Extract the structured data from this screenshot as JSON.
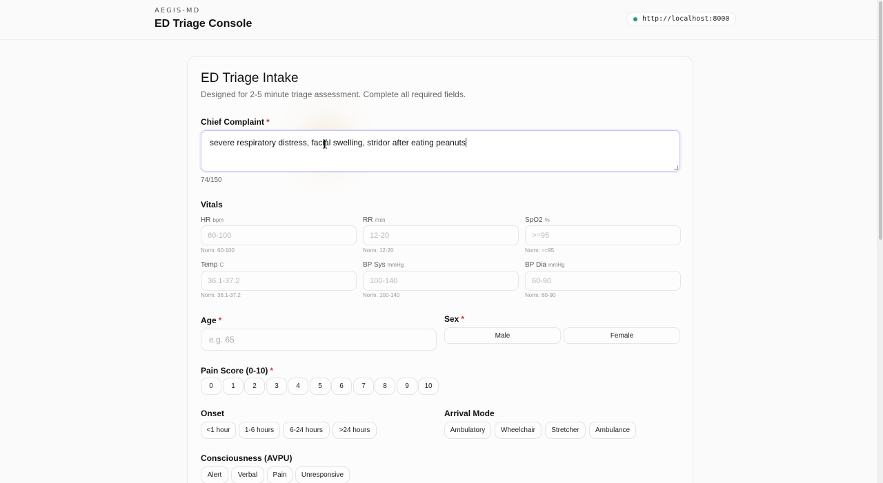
{
  "header": {
    "brand_small": "AEGIS-MD",
    "brand_title": "ED Triage Console",
    "status_url": "http://localhost:8000",
    "status_color": "#1aa06b"
  },
  "form": {
    "title": "ED Triage Intake",
    "subtitle": "Designed for 2-5 minute triage assessment. Complete all required fields.",
    "required_mark": "*",
    "chief_complaint": {
      "label": "Chief Complaint",
      "value": "severe respiratory distress, facial swelling, stridor after eating peanuts",
      "count": "74/150"
    },
    "vitals": {
      "label": "Vitals",
      "fields": [
        {
          "label": "HR",
          "unit": "bpm",
          "placeholder": "60-100",
          "norm": "Norm: 60-100"
        },
        {
          "label": "RR",
          "unit": "/min",
          "placeholder": "12-20",
          "norm": "Norm: 12-20"
        },
        {
          "label": "SpO2",
          "unit": "%",
          "placeholder": ">=95",
          "norm": "Norm: >=95"
        },
        {
          "label": "Temp",
          "unit": "C",
          "placeholder": "36.1-37.2",
          "norm": "Norm: 36.1-37.2"
        },
        {
          "label": "BP Sys",
          "unit": "mmHg",
          "placeholder": "100-140",
          "norm": "Norm: 100-140"
        },
        {
          "label": "BP Dia",
          "unit": "mmHg",
          "placeholder": "60-90",
          "norm": "Norm: 60-90"
        }
      ]
    },
    "age": {
      "label": "Age",
      "placeholder": "e.g. 65"
    },
    "sex": {
      "label": "Sex",
      "options": [
        "Male",
        "Female"
      ]
    },
    "pain": {
      "label": "Pain Score (0-10)",
      "options": [
        "0",
        "1",
        "2",
        "3",
        "4",
        "5",
        "6",
        "7",
        "8",
        "9",
        "10"
      ]
    },
    "onset": {
      "label": "Onset",
      "options": [
        "<1 hour",
        "1-6 hours",
        "6-24 hours",
        ">24 hours"
      ]
    },
    "arrival": {
      "label": "Arrival Mode",
      "options": [
        "Ambulatory",
        "Wheelchair",
        "Stretcher",
        "Ambulance"
      ]
    },
    "avpu": {
      "label": "Consciousness (AVPU)",
      "options": [
        "Alert",
        "Verbal",
        "Pain",
        "Unresponsive"
      ]
    }
  }
}
